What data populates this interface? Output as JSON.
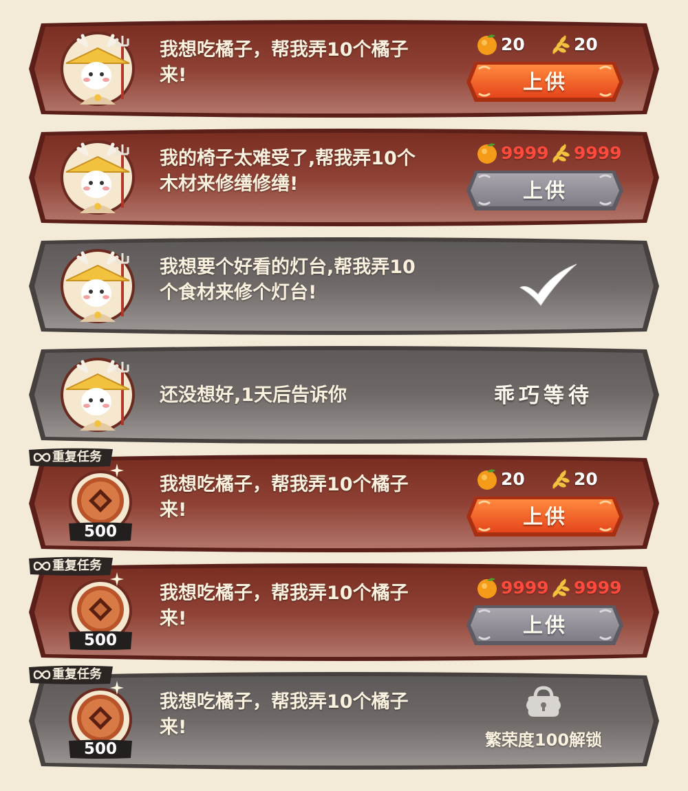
{
  "colors": {
    "active_card": "#8e4134",
    "inactive_card": "#6f6a68",
    "button_orange": "#ee5a23",
    "button_gray": "#8d8a93",
    "insufficient_red": "#ff4a3d"
  },
  "quests": [
    {
      "state": "active",
      "avatar": "deer-farmer-avatar",
      "message": "我想吃橘子，帮我弄10个橘子\n来!",
      "rewards": [
        {
          "icon": "orange-icon",
          "value": "20",
          "enough": true
        },
        {
          "icon": "wheat-icon",
          "value": "20",
          "enough": true
        }
      ],
      "button_label": "上供",
      "button_enabled": true
    },
    {
      "state": "active",
      "avatar": "deer-farmer-avatar",
      "message": "我的椅子太难受了,帮我弄10个\n木材来修缮修缮!",
      "rewards": [
        {
          "icon": "orange-icon",
          "value": "9999",
          "enough": false
        },
        {
          "icon": "wheat-icon",
          "value": "9999",
          "enough": false
        }
      ],
      "button_label": "上供",
      "button_enabled": false
    },
    {
      "state": "completed",
      "avatar": "deer-farmer-avatar",
      "message": "我想要个好看的灯台,帮我弄10\n个食材来修个灯台!",
      "status_icon": "checkmark-icon"
    },
    {
      "state": "waiting",
      "avatar": "deer-farmer-avatar",
      "message": "还没想好,1天后告诉你",
      "status_text": "乖巧等待"
    },
    {
      "state": "active",
      "repeat_tag": "重复任务",
      "reward_coin": "500",
      "message": "我想吃橘子，帮我弄10个橘子\n来!",
      "rewards": [
        {
          "icon": "orange-icon",
          "value": "20",
          "enough": true
        },
        {
          "icon": "wheat-icon",
          "value": "20",
          "enough": true
        }
      ],
      "button_label": "上供",
      "button_enabled": true
    },
    {
      "state": "active",
      "repeat_tag": "重复任务",
      "reward_coin": "500",
      "message": "我想吃橘子，帮我弄10个橘子\n来!",
      "rewards": [
        {
          "icon": "orange-icon",
          "value": "9999",
          "enough": false
        },
        {
          "icon": "wheat-icon",
          "value": "9999",
          "enough": false
        }
      ],
      "button_label": "上供",
      "button_enabled": false
    },
    {
      "state": "locked",
      "repeat_tag": "重复任务",
      "reward_coin": "500",
      "message": "我想吃橘子，帮我弄10个橘子\n来!",
      "status_icon": "lock-icon",
      "status_text": "繁荣度100解锁"
    }
  ]
}
